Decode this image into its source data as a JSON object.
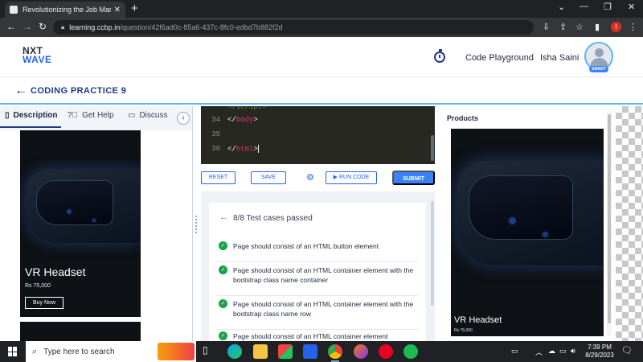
{
  "browser": {
    "tab_title": "Revolutionizing the Job Market |",
    "tab_close": "✕",
    "new_tab": "+",
    "url_host": "learning.ccbp.in",
    "url_path": "/question/42f6ad0c-85a6-437c-8fc0-edbd7b882f2d",
    "profile_initial": "I"
  },
  "header": {
    "logo_line1": "NXT",
    "logo_line2": "WAVE",
    "code_playground": "Code Playground",
    "user_name": "Isha Saini",
    "badge": "SMART"
  },
  "practice": {
    "title": "CODING PRACTICE 9"
  },
  "left_tabs": [
    {
      "label": "Description",
      "icon": "document-icon"
    },
    {
      "label": "Get Help",
      "icon": "help-icon"
    },
    {
      "label": "Discuss",
      "icon": "chat-icon"
    }
  ],
  "product_card": {
    "title": "VR Headset",
    "price": "Rs 75,000",
    "button": "Buy Now"
  },
  "editor": {
    "lines": [
      {
        "num": "34",
        "slash": "</",
        "tag": "body",
        "close": ">"
      },
      {
        "num": "35",
        "slash": "",
        "tag": "",
        "close": ""
      },
      {
        "num": "36",
        "slash": "</",
        "tag": "html",
        "close": ">"
      }
    ]
  },
  "toolbar": {
    "reset": "RESET",
    "save": "SAVE",
    "run": "▶ RUN CODE",
    "submit": "SUBMIT"
  },
  "results": {
    "title": "8/8 Test cases passed",
    "cases": [
      "Page should consist of an HTML button element",
      "Page should consist of an HTML container element with the bootstrap class name container",
      "Page should consist of an HTML container element with the bootstrap class name row",
      "Page should consist of an HTML container element"
    ]
  },
  "preview": {
    "heading": "Products",
    "card_title": "VR Headset",
    "card_price": "Rs 75,000"
  },
  "taskbar": {
    "search_placeholder": "Type here to search",
    "time": "7:39 PM",
    "date": "8/29/2023"
  },
  "colors": {
    "accent": "#2563eb",
    "editor_bg": "#272822",
    "pass_green": "#16a34a"
  }
}
